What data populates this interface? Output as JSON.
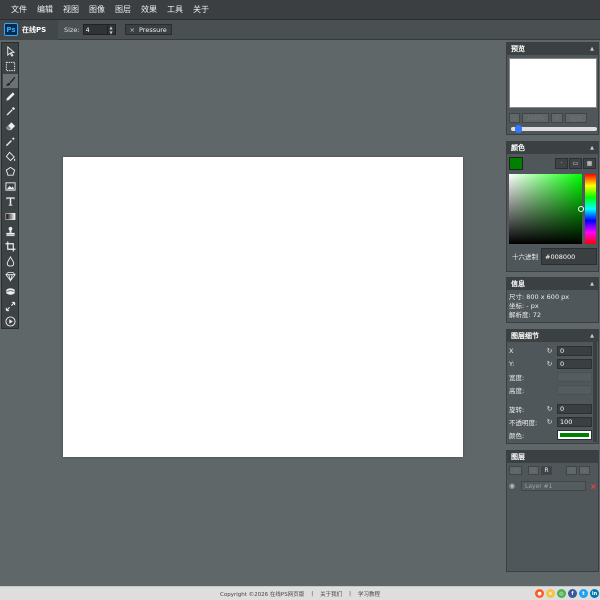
{
  "menu": [
    "文件",
    "编辑",
    "视图",
    "图像",
    "图层",
    "效果",
    "工具",
    "关于"
  ],
  "logo": {
    "mark": "Ps",
    "name": "在线PS"
  },
  "options": {
    "size_label": "Size:",
    "size_value": "4",
    "pressure_label": "Pressure",
    "pressure_close": "×"
  },
  "tools": [
    {
      "name": "move-tool",
      "icon": "pointer-icon"
    },
    {
      "name": "marquee-tool",
      "icon": "marquee-icon"
    },
    {
      "name": "brush-tool",
      "icon": "brush-icon",
      "active": true
    },
    {
      "name": "pencil-tool",
      "icon": "pencil-icon"
    },
    {
      "name": "eyedropper-tool",
      "icon": "eyedropper-icon"
    },
    {
      "name": "eraser-tool",
      "icon": "eraser-icon"
    },
    {
      "name": "magic-wand-tool",
      "icon": "magic-wand-icon"
    },
    {
      "name": "fill-tool",
      "icon": "fill-icon"
    },
    {
      "name": "shape-tool",
      "icon": "shape-icon"
    },
    {
      "name": "image-tool",
      "icon": "image-icon"
    },
    {
      "name": "text-tool",
      "icon": "text-icon"
    },
    {
      "name": "gradient-tool",
      "icon": "gradient-icon"
    },
    {
      "name": "stamp-tool",
      "icon": "stamp-icon"
    },
    {
      "name": "crop-tool",
      "icon": "crop-icon"
    },
    {
      "name": "blur-tool",
      "icon": "drop-icon"
    },
    {
      "name": "sharpen-tool",
      "icon": "diamond-icon"
    },
    {
      "name": "smudge-tool",
      "icon": "smudge-icon"
    },
    {
      "name": "zoom-tool",
      "icon": "resize-icon"
    },
    {
      "name": "play-tool",
      "icon": "play-icon"
    }
  ],
  "preview": {
    "title": "预览",
    "btn_minus": "-",
    "btn_zoom": "100%",
    "btn_plus": "+",
    "btn_fit": "适合",
    "zoom_fraction": 0.05
  },
  "color": {
    "title": "颜色",
    "hex_label": "十六进制",
    "hex_value": "#008000",
    "swatch": "#008000"
  },
  "info": {
    "title": "信息",
    "size_label": "尺寸:",
    "size_value": "800 x 600 px",
    "coord_label": "坐标:",
    "coord_value": "- px",
    "res_label": "解析度:",
    "res_value": "72"
  },
  "props": {
    "title": "图层细节",
    "x_label": "X",
    "x_value": "0",
    "y_label": "Y:",
    "y_value": "0",
    "w_label": "宽度:",
    "h_label": "高度:",
    "rot_label": "旋转:",
    "rot_value": "0",
    "op_label": "不透明度:",
    "op_value": "100",
    "col_label": "颜色:"
  },
  "layers": {
    "title": "图层",
    "add_label": "+",
    "d_label": "D",
    "r_label": "R",
    "up_label": "↑",
    "down_label": "↓",
    "layer_name": "Layer #1",
    "delete": "×"
  },
  "footer": {
    "copyright": "Copyright ©2026 在线PS网页版",
    "sep": "|",
    "about": "关于我们",
    "learn": "学习教程"
  },
  "social_colors": [
    "#ff5a1f",
    "#f6c343",
    "#4caf50",
    "#3b5998",
    "#1da1f2",
    "#0077b5"
  ]
}
